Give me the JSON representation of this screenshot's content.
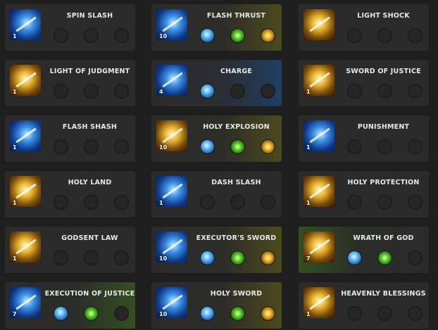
{
  "skills": [
    {
      "name": "SPIN SLASH",
      "level": "1",
      "icon": "spin-slash-icon",
      "icon_color": "blue",
      "glow": "",
      "gems": [
        "",
        "",
        ""
      ]
    },
    {
      "name": "FLASH THRUST",
      "level": "10",
      "icon": "flash-thrust-icon",
      "icon_color": "blue",
      "glow": "yellow",
      "gems": [
        "blue",
        "green",
        "gold"
      ]
    },
    {
      "name": "LIGHT SHOCK",
      "level": "",
      "icon": "light-shock-icon",
      "icon_color": "gold",
      "glow": "",
      "gems": [
        "",
        "",
        ""
      ]
    },
    {
      "name": "LIGHT OF JUDGMENT",
      "level": "1",
      "icon": "light-of-judgment-icon",
      "icon_color": "gold",
      "glow": "",
      "gems": [
        "",
        "",
        ""
      ]
    },
    {
      "name": "CHARGE",
      "level": "4",
      "icon": "charge-icon",
      "icon_color": "blue",
      "glow": "blue",
      "gems": [
        "blue",
        "",
        ""
      ]
    },
    {
      "name": "SWORD OF JUSTICE",
      "level": "1",
      "icon": "sword-of-justice-icon",
      "icon_color": "gold",
      "glow": "",
      "gems": [
        "",
        "",
        ""
      ]
    },
    {
      "name": "FLASH SHASH",
      "level": "1",
      "icon": "flash-shash-icon",
      "icon_color": "blue",
      "glow": "",
      "gems": [
        "",
        "",
        ""
      ]
    },
    {
      "name": "HOLY EXPLOSION",
      "level": "10",
      "icon": "holy-explosion-icon",
      "icon_color": "gold",
      "glow": "yellow",
      "gems": [
        "blue",
        "green",
        "gold"
      ]
    },
    {
      "name": "PUNISHMENT",
      "level": "1",
      "icon": "punishment-icon",
      "icon_color": "blue",
      "glow": "",
      "gems": [
        "",
        "",
        ""
      ]
    },
    {
      "name": "HOLY LAND",
      "level": "1",
      "icon": "holy-land-icon",
      "icon_color": "gold",
      "glow": "",
      "gems": [
        "",
        "",
        ""
      ]
    },
    {
      "name": "DASH SLASH",
      "level": "1",
      "icon": "dash-slash-icon",
      "icon_color": "blue",
      "glow": "",
      "gems": [
        "",
        "",
        ""
      ]
    },
    {
      "name": "HOLY PROTECTION",
      "level": "1",
      "icon": "holy-protection-icon",
      "icon_color": "gold",
      "glow": "",
      "gems": [
        "",
        "",
        ""
      ]
    },
    {
      "name": "GODSENT LAW",
      "level": "1",
      "icon": "godsent-law-icon",
      "icon_color": "gold",
      "glow": "",
      "gems": [
        "",
        "",
        ""
      ]
    },
    {
      "name": "EXECUTOR'S SWORD",
      "level": "10",
      "icon": "executors-sword-icon",
      "icon_color": "blue",
      "glow": "yellow",
      "gems": [
        "blue",
        "green",
        "gold"
      ]
    },
    {
      "name": "WRATH OF GOD",
      "level": "7",
      "icon": "wrath-of-god-icon",
      "icon_color": "gold",
      "glow": "green",
      "gems": [
        "blue",
        "green",
        ""
      ]
    },
    {
      "name": "EXECUTION OF JUSTICE",
      "level": "7",
      "icon": "execution-of-justice-icon",
      "icon_color": "blue",
      "glow": "green",
      "gems": [
        "blue",
        "green",
        ""
      ]
    },
    {
      "name": "HOLY SWORD",
      "level": "10",
      "icon": "holy-sword-icon",
      "icon_color": "blue",
      "glow": "yellow",
      "gems": [
        "blue",
        "green",
        "gold"
      ]
    },
    {
      "name": "HEAVENLY BLESSINGS",
      "level": "1",
      "icon": "heavenly-blessings-icon",
      "icon_color": "gold",
      "glow": "",
      "gems": [
        "",
        "",
        ""
      ]
    }
  ]
}
